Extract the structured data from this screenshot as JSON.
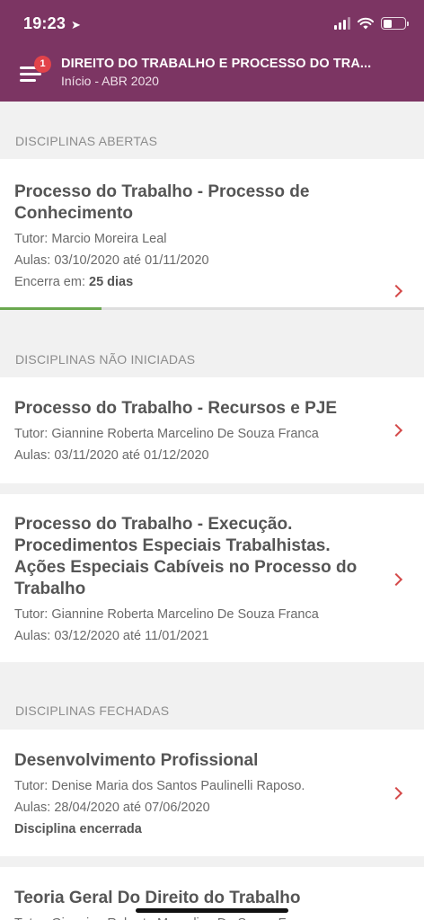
{
  "status_bar": {
    "time": "19:23",
    "location_icon": "location-arrow-icon",
    "battery_level": 0.42
  },
  "header": {
    "notification_count": "1",
    "title": "DIREITO DO TRABALHO E PROCESSO DO TRA...",
    "subtitle": "Início - ABR 2020",
    "menu_icon": "hamburger-menu-icon",
    "background_color": "#7c3563"
  },
  "sections": {
    "open": {
      "label": "DISCIPLINAS ABERTAS",
      "cards": [
        {
          "title": "Processo do Trabalho - Processo de Conhecimento",
          "tutor": "Tutor: Marcio Moreira Leal",
          "classes": "Aulas: 03/10/2020 até 01/11/2020",
          "ends_prefix": "Encerra em: ",
          "ends_value": "25 dias",
          "progress": 0.24
        }
      ]
    },
    "not_started": {
      "label": "DISCIPLINAS NÃO INICIADAS",
      "cards": [
        {
          "title": "Processo do Trabalho - Recursos e PJE",
          "tutor": "Tutor: Giannine Roberta Marcelino De Souza Franca",
          "classes": "Aulas: 03/11/2020 até 01/12/2020"
        },
        {
          "title": "Processo do Trabalho - Execução. Procedimentos Especiais Trabalhistas. Ações Especiais Cabíveis no Processo do Trabalho",
          "tutor": "Tutor: Giannine Roberta Marcelino De Souza Franca",
          "classes": "Aulas: 03/12/2020 até 11/01/2021"
        }
      ]
    },
    "closed": {
      "label": "DISCIPLINAS FECHADAS",
      "cards": [
        {
          "title": "Desenvolvimento Profissional",
          "tutor": "Tutor: Denise Maria dos Santos Paulinelli Raposo.",
          "classes": "Aulas: 28/04/2020 até 07/06/2020",
          "status": "Disciplina encerrada"
        },
        {
          "title": "Teoria Geral Do Direito do Trabalho",
          "tutor": "Tutor: Giannine Roberta Marcelino De Souza Franca"
        }
      ]
    }
  },
  "colors": {
    "accent_chevron": "#d44a4a",
    "progress_fill": "#6aa84f",
    "badge": "#e2434a"
  }
}
